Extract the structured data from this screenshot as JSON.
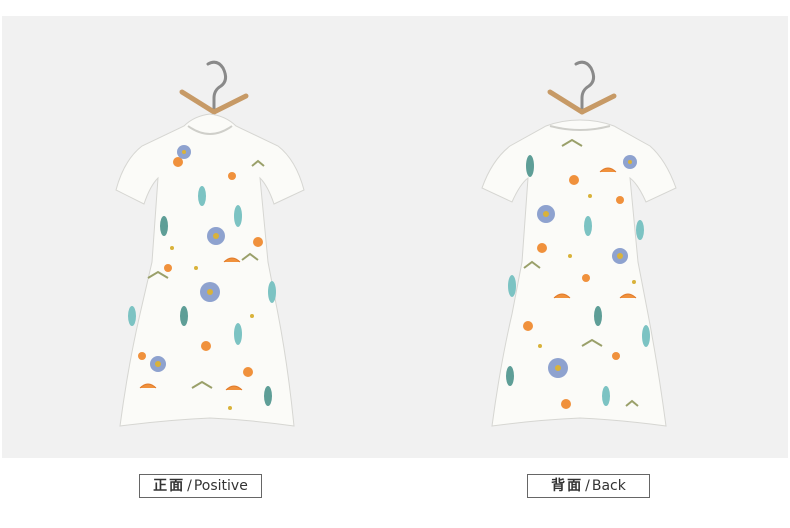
{
  "labels": {
    "front": {
      "cn": "正面",
      "sep": "/",
      "en": "Positive"
    },
    "back": {
      "cn": "背面",
      "sep": "/",
      "en": "Back"
    }
  },
  "colors": {
    "panel_background": "#f1f1f1",
    "garment_fabric": "#fbfbf8",
    "hanger_wood": "#c79a66",
    "hanger_hook": "#8a8a8a",
    "print_teal": "#7cc3c3",
    "print_blue": "#8ea2cf",
    "print_orange": "#f0913c",
    "print_yellow": "#d9b23a",
    "print_olive": "#9aa06a",
    "print_leaf": "#5e9e97"
  },
  "icons": {
    "hanger": "hanger-icon",
    "dress_front": "dress-front-illustration",
    "dress_back": "dress-back-illustration"
  }
}
